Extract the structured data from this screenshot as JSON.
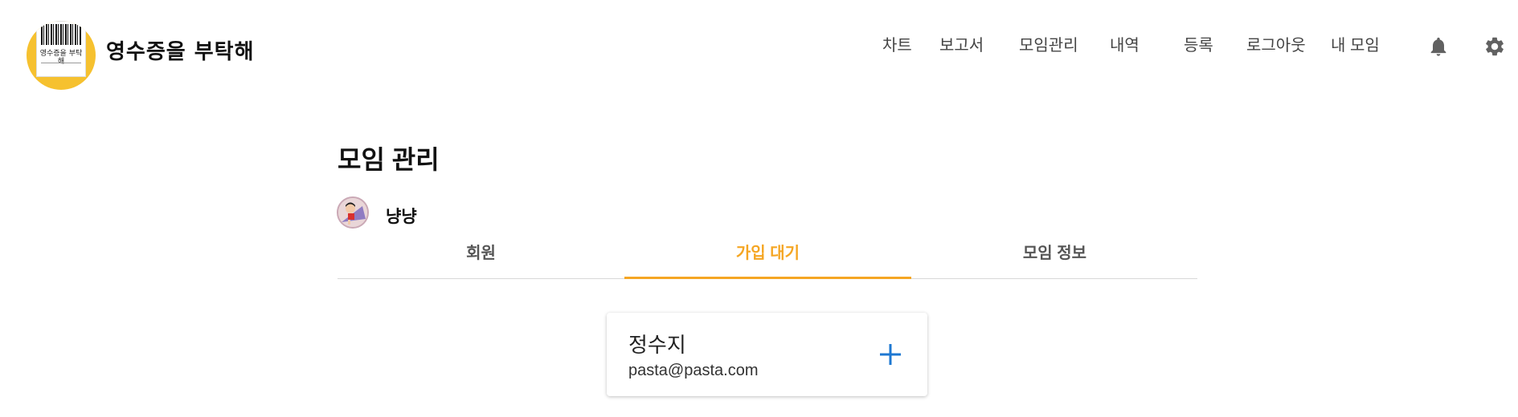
{
  "brand": {
    "logo_text": "영수증을 부탁해",
    "name": "영수증을 부탁해"
  },
  "nav": {
    "items": [
      {
        "label": "차트"
      },
      {
        "label": "보고서"
      },
      {
        "label": "모임관리"
      },
      {
        "label": "내역"
      },
      {
        "label": "등록"
      },
      {
        "label": "로그아웃"
      },
      {
        "label": "내 모임"
      }
    ],
    "icons": [
      "bell-icon",
      "gear-icon"
    ]
  },
  "page": {
    "title": "모임 관리",
    "group_name": "냥냥"
  },
  "tabs": [
    {
      "label": "회원",
      "active": false
    },
    {
      "label": "가입 대기",
      "active": true
    },
    {
      "label": "모임 정보",
      "active": false
    }
  ],
  "pending_members": [
    {
      "name": "정수지",
      "email": "pasta@pasta.com",
      "action_icon": "plus-icon"
    }
  ],
  "colors": {
    "accent": "#f5a623",
    "logo_bg": "#f6c12f",
    "add_icon": "#1e78d2",
    "icon_gray": "#616161"
  }
}
